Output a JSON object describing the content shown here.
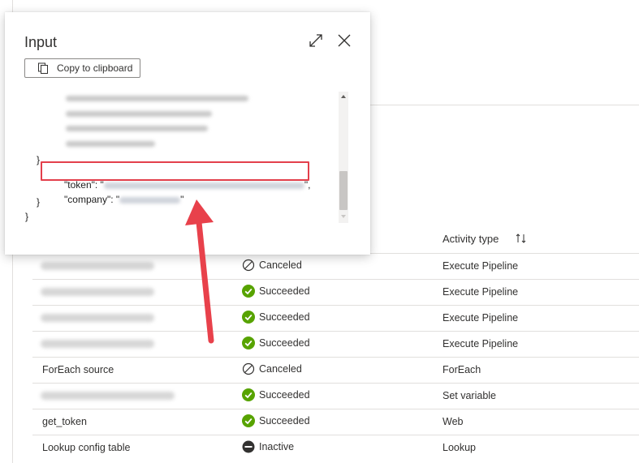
{
  "panel": {
    "title": "Input",
    "copy_label": "Copy to clipboard",
    "icons": {
      "expand": "expand-icon",
      "close": "close-icon",
      "copy": "copy-icon"
    },
    "code": {
      "close_inner_brace": "},",
      "token_key": "\"token\": \"",
      "token_end": "\",",
      "company_key": "\"company\": \"",
      "company_end": "\"",
      "close_brace_1": "}",
      "close_brace_2": "}"
    }
  },
  "table": {
    "header": {
      "activity_type": "Activity type",
      "sort_icon": "sort-icon"
    },
    "rows": [
      {
        "name": "",
        "status": "Canceled",
        "status_icon": "canceled-icon",
        "type": "Execute Pipeline"
      },
      {
        "name": "",
        "status": "Succeeded",
        "status_icon": "succeeded-icon",
        "type": "Execute Pipeline"
      },
      {
        "name": "",
        "status": "Succeeded",
        "status_icon": "succeeded-icon",
        "type": "Execute Pipeline"
      },
      {
        "name": "",
        "status": "Succeeded",
        "status_icon": "succeeded-icon",
        "type": "Execute Pipeline"
      },
      {
        "name": "ForEach source",
        "status": "Canceled",
        "status_icon": "canceled-icon",
        "type": "ForEach"
      },
      {
        "name": "",
        "status": "Succeeded",
        "status_icon": "succeeded-icon",
        "type": "Set variable"
      },
      {
        "name": "get_token",
        "status": "Succeeded",
        "status_icon": "succeeded-icon",
        "type": "Web"
      },
      {
        "name": "Lookup config table",
        "status": "Inactive",
        "status_icon": "inactive-icon",
        "type": "Lookup"
      }
    ]
  },
  "colors": {
    "succeeded": "#57a300",
    "highlight": "#e33f4b",
    "arrow": "#e8414b"
  }
}
